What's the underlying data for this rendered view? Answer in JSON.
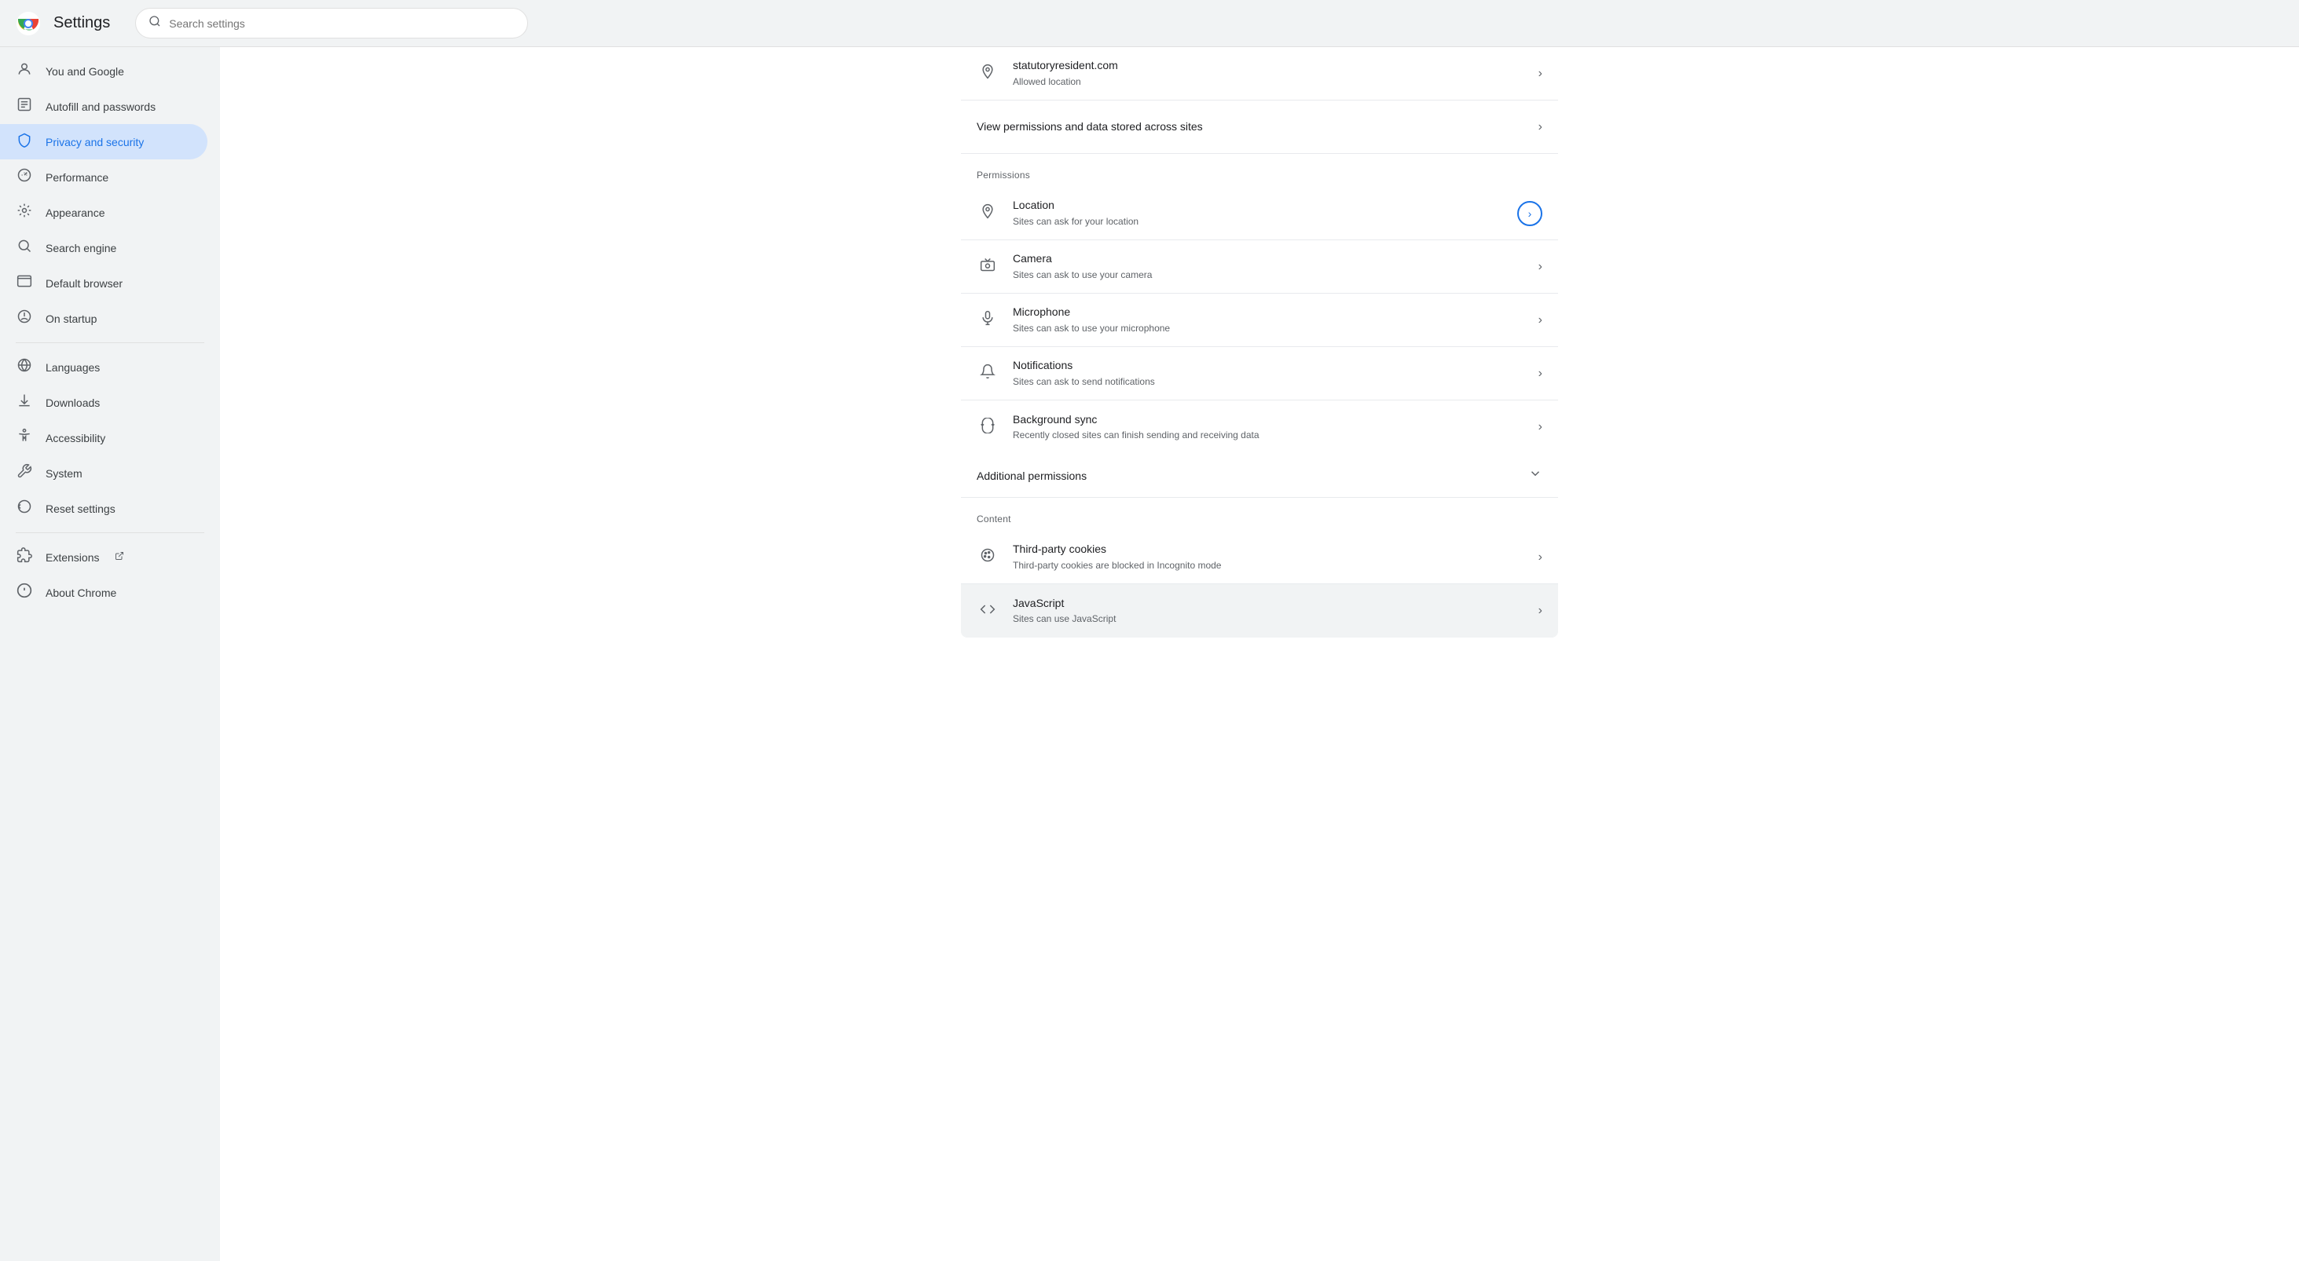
{
  "topbar": {
    "title": "Settings",
    "search_placeholder": "Search settings"
  },
  "sidebar": {
    "items": [
      {
        "id": "you-and-google",
        "label": "You and Google",
        "icon": "👤"
      },
      {
        "id": "autofill",
        "label": "Autofill and passwords",
        "icon": "📋"
      },
      {
        "id": "privacy",
        "label": "Privacy and security",
        "icon": "🛡️",
        "active": true
      },
      {
        "id": "performance",
        "label": "Performance",
        "icon": "⚡"
      },
      {
        "id": "appearance",
        "label": "Appearance",
        "icon": "🎨"
      },
      {
        "id": "search-engine",
        "label": "Search engine",
        "icon": "🔍"
      },
      {
        "id": "default-browser",
        "label": "Default browser",
        "icon": "💻"
      },
      {
        "id": "on-startup",
        "label": "On startup",
        "icon": "⏻"
      },
      {
        "id": "languages",
        "label": "Languages",
        "icon": "🌐"
      },
      {
        "id": "downloads",
        "label": "Downloads",
        "icon": "⬇️"
      },
      {
        "id": "accessibility",
        "label": "Accessibility",
        "icon": "♿"
      },
      {
        "id": "system",
        "label": "System",
        "icon": "🔧"
      },
      {
        "id": "reset-settings",
        "label": "Reset settings",
        "icon": "🔄"
      },
      {
        "id": "extensions",
        "label": "Extensions",
        "icon": "🧩",
        "has_ext": true
      },
      {
        "id": "about-chrome",
        "label": "About Chrome",
        "icon": "ⓘ"
      }
    ]
  },
  "content": {
    "site_row": {
      "icon": "📍",
      "title": "statutoryresident.com",
      "subtitle": "Allowed location"
    },
    "view_permissions_row": {
      "title": "View permissions and data stored across sites"
    },
    "permissions_section_header": "Permissions",
    "permissions": [
      {
        "id": "location",
        "icon": "📍",
        "title": "Location",
        "subtitle": "Sites can ask for your location",
        "highlighted": true,
        "circled_arrow": true
      },
      {
        "id": "camera",
        "icon": "📷",
        "title": "Camera",
        "subtitle": "Sites can ask to use your camera",
        "highlighted": false,
        "circled_arrow": false
      },
      {
        "id": "microphone",
        "icon": "🎤",
        "title": "Microphone",
        "subtitle": "Sites can ask to use your microphone",
        "highlighted": false,
        "circled_arrow": false
      },
      {
        "id": "notifications",
        "icon": "🔔",
        "title": "Notifications",
        "subtitle": "Sites can ask to send notifications",
        "highlighted": false,
        "circled_arrow": false
      },
      {
        "id": "background-sync",
        "icon": "🔁",
        "title": "Background sync",
        "subtitle": "Recently closed sites can finish sending and receiving data",
        "highlighted": false,
        "circled_arrow": false
      }
    ],
    "additional_permissions": {
      "label": "Additional permissions"
    },
    "content_section_header": "Content",
    "content_items": [
      {
        "id": "third-party-cookies",
        "icon": "🍪",
        "title": "Third-party cookies",
        "subtitle": "Third-party cookies are blocked in Incognito mode"
      },
      {
        "id": "javascript",
        "icon": "<>",
        "title": "JavaScript",
        "subtitle": "Sites can use JavaScript",
        "highlighted": true
      }
    ]
  },
  "icons": {
    "search": "🔍",
    "chevron_right": "›",
    "chevron_down": "∨",
    "external": "↗"
  }
}
